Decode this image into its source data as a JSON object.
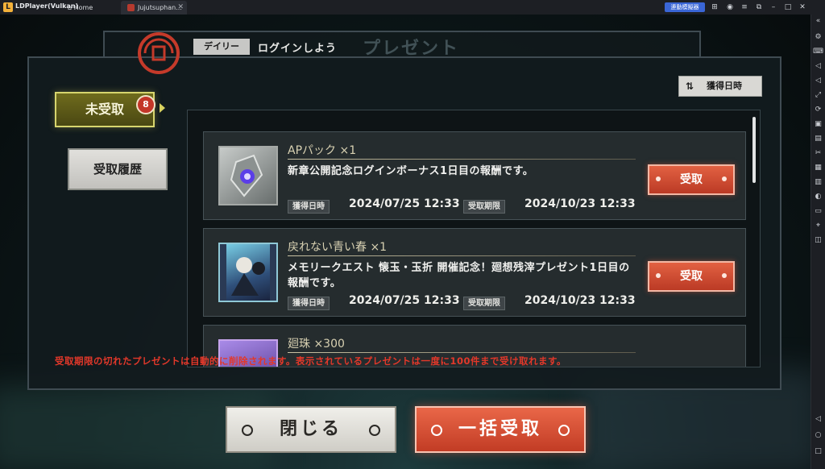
{
  "emulator": {
    "app_name": "LDPlayer(Vulkan)",
    "tabs": [
      {
        "label": "Home"
      },
      {
        "label": "Jujutsuphan..."
      }
    ],
    "badge_label": "連動模擬器"
  },
  "header": {
    "ghost_title": "プレゼント",
    "category_tag": "デイリー",
    "category_text": "ログインしよう"
  },
  "tabs": {
    "unreceived": {
      "label": "未受取",
      "badge_count": "8"
    },
    "history": {
      "label": "受取履歴"
    }
  },
  "sort": {
    "label": "獲得日時"
  },
  "items": [
    {
      "name": "APパック ×1",
      "description": "新章公開記念ログインボーナス1日目の報酬です。",
      "acquired_label": "獲得日時",
      "acquired_value": "2024/07/25 12:33",
      "expire_label": "受取期限",
      "expire_value": "2024/10/23 12:33",
      "receive_label": "受取",
      "icon": "ap-pack-icon"
    },
    {
      "name": "戻れない青い春 ×1",
      "description": "メモリークエスト 懐玉・玉折 開催記念！廻想残滓プレゼント1日目の報酬です。",
      "acquired_label": "獲得日時",
      "acquired_value": "2024/07/25 12:33",
      "expire_label": "受取期限",
      "expire_value": "2024/10/23 12:33",
      "receive_label": "受取",
      "icon": "memory-card-icon"
    },
    {
      "name": "廻珠 ×300",
      "icon": "kaiju-orb-icon"
    }
  ],
  "notice": "受取期限の切れたプレゼントは自動的に削除されます。表示されているプレゼントは一度に100件まで受け取れます。",
  "footer": {
    "close_label": "閉じる",
    "bulk_label": "一括受取"
  },
  "colors": {
    "accent_red": "#d9472e",
    "tab_active": "#6f6b1d",
    "panel": "#252c2e"
  }
}
